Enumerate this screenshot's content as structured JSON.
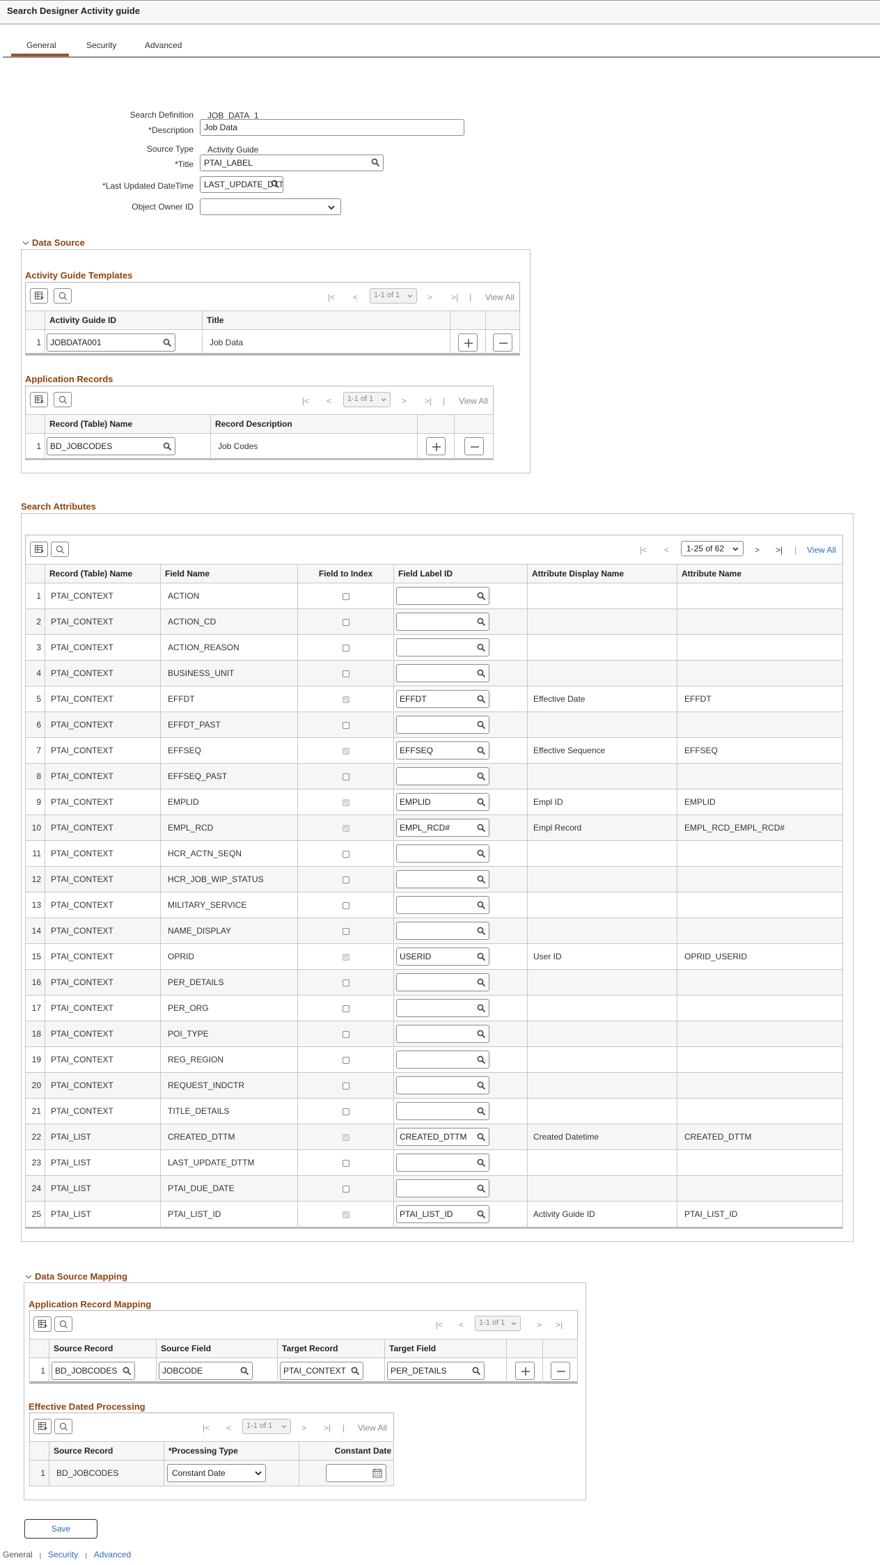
{
  "page": {
    "title": "Search Designer Activity guide",
    "tabs": [
      {
        "label": "General",
        "active": true
      },
      {
        "label": "Security",
        "active": false
      },
      {
        "label": "Advanced",
        "active": false
      }
    ]
  },
  "form": {
    "search_definition_label": "Search Definition",
    "search_definition_value": "JOB_DATA_1",
    "description_label": "*Description",
    "description_value": "Job Data",
    "source_type_label": "Source Type",
    "source_type_value": "Activity Guide",
    "title_label": "*Title",
    "title_value": "PTAI_LABEL",
    "last_updated_label": "*Last Updated DateTime",
    "last_updated_value": "LAST_UPDATE_DTT",
    "owner_label": "Object Owner ID",
    "owner_value": ""
  },
  "icons": {
    "search": "search-icon",
    "personalize": "grid-personalize-icon",
    "first": "first-page-icon",
    "prev": "previous-page-icon",
    "next": "next-page-icon",
    "last": "last-page-icon",
    "add": "plus-icon",
    "delete": "minus-icon",
    "calendar": "calendar-icon",
    "chevron": "chevron-down-icon"
  },
  "colors": {
    "accent": "#8b4513",
    "tab_underline": "#a0522d",
    "link": "#2e6db4",
    "row_alt": "#f7f6f4"
  },
  "data_source": {
    "title": "Data Source",
    "ag_templates": {
      "title": "Activity Guide Templates",
      "pager": "1-1 of 1",
      "view_all": "View All",
      "columns": [
        "Activity Guide ID",
        "Title"
      ],
      "rows": [
        {
          "num": "1",
          "id": "JOBDATA001",
          "title": "Job Data"
        }
      ]
    },
    "app_records": {
      "title": "Application Records",
      "pager": "1-1 of 1",
      "view_all": "View All",
      "columns": [
        "Record (Table) Name",
        "Record Description"
      ],
      "rows": [
        {
          "num": "1",
          "record": "BD_JOBCODES",
          "description": "Job Codes"
        }
      ]
    }
  },
  "search_attributes": {
    "title": "Search Attributes",
    "pager": "1-25 of 62",
    "view_all": "View All",
    "columns": [
      "Record (Table) Name",
      "Field Name",
      "Field to Index",
      "Field Label ID",
      "Attribute Display Name",
      "Attribute Name"
    ],
    "rows": [
      {
        "num": "1",
        "record": "PTAI_CONTEXT",
        "field": "ACTION",
        "indexed": false,
        "label_id": "",
        "display": "",
        "attr": ""
      },
      {
        "num": "2",
        "record": "PTAI_CONTEXT",
        "field": "ACTION_CD",
        "indexed": false,
        "label_id": "",
        "display": "",
        "attr": ""
      },
      {
        "num": "3",
        "record": "PTAI_CONTEXT",
        "field": "ACTION_REASON",
        "indexed": false,
        "label_id": "",
        "display": "",
        "attr": ""
      },
      {
        "num": "4",
        "record": "PTAI_CONTEXT",
        "field": "BUSINESS_UNIT",
        "indexed": false,
        "label_id": "",
        "display": "",
        "attr": ""
      },
      {
        "num": "5",
        "record": "PTAI_CONTEXT",
        "field": "EFFDT",
        "indexed": true,
        "label_id": "EFFDT",
        "display": "Effective Date",
        "attr": "EFFDT"
      },
      {
        "num": "6",
        "record": "PTAI_CONTEXT",
        "field": "EFFDT_PAST",
        "indexed": false,
        "label_id": "",
        "display": "",
        "attr": ""
      },
      {
        "num": "7",
        "record": "PTAI_CONTEXT",
        "field": "EFFSEQ",
        "indexed": true,
        "label_id": "EFFSEQ",
        "display": "Effective Sequence",
        "attr": "EFFSEQ"
      },
      {
        "num": "8",
        "record": "PTAI_CONTEXT",
        "field": "EFFSEQ_PAST",
        "indexed": false,
        "label_id": "",
        "display": "",
        "attr": ""
      },
      {
        "num": "9",
        "record": "PTAI_CONTEXT",
        "field": "EMPLID",
        "indexed": true,
        "label_id": "EMPLID",
        "display": "Empl ID",
        "attr": "EMPLID"
      },
      {
        "num": "10",
        "record": "PTAI_CONTEXT",
        "field": "EMPL_RCD",
        "indexed": true,
        "label_id": "EMPL_RCD#",
        "display": "Empl Record",
        "attr": "EMPL_RCD_EMPL_RCD#"
      },
      {
        "num": "11",
        "record": "PTAI_CONTEXT",
        "field": "HCR_ACTN_SEQN",
        "indexed": false,
        "label_id": "",
        "display": "",
        "attr": ""
      },
      {
        "num": "12",
        "record": "PTAI_CONTEXT",
        "field": "HCR_JOB_WIP_STATUS",
        "indexed": false,
        "label_id": "",
        "display": "",
        "attr": ""
      },
      {
        "num": "13",
        "record": "PTAI_CONTEXT",
        "field": "MILITARY_SERVICE",
        "indexed": false,
        "label_id": "",
        "display": "",
        "attr": ""
      },
      {
        "num": "14",
        "record": "PTAI_CONTEXT",
        "field": "NAME_DISPLAY",
        "indexed": false,
        "label_id": "",
        "display": "",
        "attr": ""
      },
      {
        "num": "15",
        "record": "PTAI_CONTEXT",
        "field": "OPRID",
        "indexed": true,
        "label_id": "USERID",
        "display": "User ID",
        "attr": "OPRID_USERID"
      },
      {
        "num": "16",
        "record": "PTAI_CONTEXT",
        "field": "PER_DETAILS",
        "indexed": false,
        "label_id": "",
        "display": "",
        "attr": ""
      },
      {
        "num": "17",
        "record": "PTAI_CONTEXT",
        "field": "PER_ORG",
        "indexed": false,
        "label_id": "",
        "display": "",
        "attr": ""
      },
      {
        "num": "18",
        "record": "PTAI_CONTEXT",
        "field": "POI_TYPE",
        "indexed": false,
        "label_id": "",
        "display": "",
        "attr": ""
      },
      {
        "num": "19",
        "record": "PTAI_CONTEXT",
        "field": "REG_REGION",
        "indexed": false,
        "label_id": "",
        "display": "",
        "attr": ""
      },
      {
        "num": "20",
        "record": "PTAI_CONTEXT",
        "field": "REQUEST_INDCTR",
        "indexed": false,
        "label_id": "",
        "display": "",
        "attr": ""
      },
      {
        "num": "21",
        "record": "PTAI_CONTEXT",
        "field": "TITLE_DETAILS",
        "indexed": false,
        "label_id": "",
        "display": "",
        "attr": ""
      },
      {
        "num": "22",
        "record": "PTAI_LIST",
        "field": "CREATED_DTTM",
        "indexed": true,
        "label_id": "CREATED_DTTM",
        "display": "Created Datetime",
        "attr": "CREATED_DTTM"
      },
      {
        "num": "23",
        "record": "PTAI_LIST",
        "field": "LAST_UPDATE_DTTM",
        "indexed": false,
        "label_id": "",
        "display": "",
        "attr": ""
      },
      {
        "num": "24",
        "record": "PTAI_LIST",
        "field": "PTAI_DUE_DATE",
        "indexed": false,
        "label_id": "",
        "display": "",
        "attr": ""
      },
      {
        "num": "25",
        "record": "PTAI_LIST",
        "field": "PTAI_LIST_ID",
        "indexed": true,
        "label_id": "PTAI_LIST_ID",
        "display": "Activity Guide ID",
        "attr": "PTAI_LIST_ID"
      }
    ]
  },
  "data_source_mapping": {
    "title": "Data Source Mapping",
    "app_record_mapping": {
      "title": "Application Record Mapping",
      "pager": "1-1 of 1",
      "columns": [
        "Source Record",
        "Source Field",
        "Target Record",
        "Target Field"
      ],
      "rows": [
        {
          "num": "1",
          "source_record": "BD_JOBCODES",
          "source_field": "JOBCODE",
          "target_record": "PTAI_CONTEXT",
          "target_field": "PER_DETAILS"
        }
      ]
    },
    "effdt_processing": {
      "title": "Effective Dated Processing",
      "pager": "1-1 of 1",
      "view_all": "View All",
      "columns": [
        "Source Record",
        "*Processing Type",
        "Constant Date"
      ],
      "rows": [
        {
          "num": "1",
          "source_record": "BD_JOBCODES",
          "processing_type": "Constant Date",
          "constant_date": ""
        }
      ]
    }
  },
  "actions": {
    "save_label": "Save"
  },
  "footer": {
    "links": [
      {
        "label": "General",
        "current": true
      },
      {
        "label": "Security",
        "current": false
      },
      {
        "label": "Advanced",
        "current": false
      }
    ],
    "separator": "|"
  }
}
